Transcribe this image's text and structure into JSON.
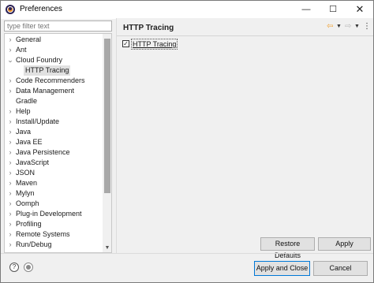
{
  "window": {
    "title": "Preferences",
    "minimize": "—",
    "maximize": "☐",
    "close": "✕"
  },
  "filter": {
    "placeholder": "type filter text"
  },
  "tree": {
    "items": [
      {
        "label": "General",
        "arrow": "›",
        "expanded": false
      },
      {
        "label": "Ant",
        "arrow": "›",
        "expanded": false
      },
      {
        "label": "Cloud Foundry",
        "arrow": "⌄",
        "expanded": true
      },
      {
        "label": "HTTP Tracing",
        "arrow": "",
        "child": true,
        "selected": true
      },
      {
        "label": "Code Recommenders",
        "arrow": "›"
      },
      {
        "label": "Data Management",
        "arrow": "›"
      },
      {
        "label": "Gradle",
        "arrow": ""
      },
      {
        "label": "Help",
        "arrow": "›"
      },
      {
        "label": "Install/Update",
        "arrow": "›"
      },
      {
        "label": "Java",
        "arrow": "›"
      },
      {
        "label": "Java EE",
        "arrow": "›"
      },
      {
        "label": "Java Persistence",
        "arrow": "›"
      },
      {
        "label": "JavaScript",
        "arrow": "›"
      },
      {
        "label": "JSON",
        "arrow": "›"
      },
      {
        "label": "Maven",
        "arrow": "›"
      },
      {
        "label": "Mylyn",
        "arrow": "›"
      },
      {
        "label": "Oomph",
        "arrow": "›"
      },
      {
        "label": "Plug-in Development",
        "arrow": "›"
      },
      {
        "label": "Profiling",
        "arrow": "›"
      },
      {
        "label": "Remote Systems",
        "arrow": "›"
      },
      {
        "label": "Run/Debug",
        "arrow": "›"
      }
    ]
  },
  "page": {
    "title": "HTTP Tracing",
    "nav": {
      "back": "⇦",
      "back_dropdown": "▼",
      "forward": "⇨",
      "forward_dropdown": "▼",
      "menu": "⋮"
    },
    "checkbox": {
      "label": "HTTP Tracing",
      "checked": true,
      "mark": "✓"
    },
    "restore_defaults": "Restore Defaults",
    "apply": "Apply"
  },
  "footer": {
    "help": "?",
    "apply_and_close": "Apply and Close",
    "cancel": "Cancel"
  },
  "colors": {
    "accent": "#0078d7",
    "selection": "#e1e1e1",
    "back_arrow": "#f0a030"
  }
}
